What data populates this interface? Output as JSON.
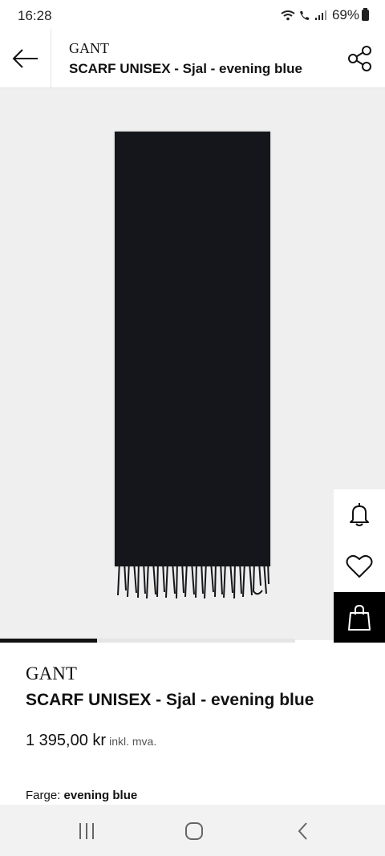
{
  "status_bar": {
    "time": "16:28",
    "battery": "69%",
    "icons": [
      "wifi-icon",
      "call-icon",
      "signal-icon",
      "battery-icon"
    ]
  },
  "header": {
    "brand": "GANT",
    "title": "SCARF UNISEX - Sjal - evening blue",
    "back_icon": "arrow-left-icon",
    "share_icon": "share-icon"
  },
  "gallery": {
    "image": "scarf-evening-blue",
    "scarf_color": "#15161b",
    "progress": 0.33,
    "side_actions": [
      {
        "name": "notify-button",
        "icon": "bell-icon"
      },
      {
        "name": "wishlist-button",
        "icon": "heart-icon"
      },
      {
        "name": "add-to-bag-button",
        "icon": "bag-icon"
      }
    ]
  },
  "product": {
    "brand": "GANT",
    "title": "SCARF UNISEX - Sjal - evening blue",
    "price": "1 395,00 kr",
    "vat_note": "inkl. mva.",
    "color_label": "Farge:",
    "color_value": "evening blue"
  },
  "nav_bar": {
    "buttons": [
      "recent-apps-icon",
      "home-icon",
      "back-icon"
    ]
  }
}
